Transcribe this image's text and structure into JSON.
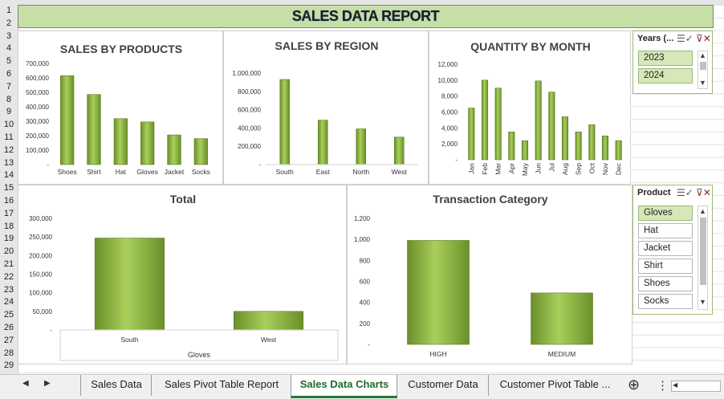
{
  "sheet": {
    "title": "SALES DATA REPORT",
    "row_numbers": [
      "1",
      "2",
      "3",
      "4",
      "5",
      "6",
      "7",
      "8",
      "9",
      "10",
      "11",
      "12",
      "13",
      "14",
      "15",
      "16",
      "17",
      "18",
      "19",
      "20",
      "21",
      "22",
      "23",
      "24",
      "25",
      "26",
      "27",
      "28",
      "29"
    ]
  },
  "colors": {
    "bar_light": "#a9cf5b",
    "bar_dark": "#6b8f2a",
    "accent_green": "#1e7b34",
    "slicer_selected": "#d6e8b8"
  },
  "chart_data": [
    {
      "type": "bar",
      "title": "SALES  BY PRODUCTS",
      "categories": [
        "Shoes",
        "Shirt",
        "Hat",
        "Gloves",
        "Jacket",
        "Socks"
      ],
      "values": [
        615000,
        485000,
        318000,
        295000,
        205000,
        180000
      ],
      "ylim": [
        0,
        700000
      ],
      "ytick_labels": [
        "-",
        "100,000",
        "200,000",
        "300,000",
        "400,000",
        "500,000",
        "600,000",
        "700,000"
      ]
    },
    {
      "type": "bar",
      "title": "SALES BY REGION",
      "categories": [
        "South",
        "East",
        "North",
        "West"
      ],
      "values": [
        930000,
        485000,
        390000,
        300000
      ],
      "ylim": [
        0,
        1000000
      ],
      "ytick_labels": [
        "-",
        "200,000",
        "400,000",
        "600,000",
        "800,000",
        "1,000,000"
      ]
    },
    {
      "type": "bar",
      "title": "QUANTITY BY MONTH",
      "categories": [
        "Jan",
        "Feb",
        "Mar",
        "Apr",
        "May",
        "Jun",
        "Jul",
        "Aug",
        "Sep",
        "Oct",
        "Nov",
        "Dec"
      ],
      "values": [
        6500,
        10000,
        9000,
        3500,
        2400,
        9900,
        8500,
        5400,
        3500,
        4400,
        3000,
        2400
      ],
      "ylim": [
        0,
        12000
      ],
      "ytick_labels": [
        "-",
        "2,000",
        "4,000",
        "6,000",
        "8,000",
        "10,000",
        "12,000"
      ]
    },
    {
      "type": "bar",
      "title": "Total",
      "categories": [
        "South",
        "West"
      ],
      "group_label": "Gloves",
      "values": [
        247000,
        50000
      ],
      "ylim": [
        0,
        300000
      ],
      "ytick_labels": [
        "-",
        "50,000",
        "100,000",
        "150,000",
        "200,000",
        "250,000",
        "300,000"
      ]
    },
    {
      "type": "bar",
      "title": "Transaction Category",
      "categories": [
        "HIGH",
        "MEDIUM"
      ],
      "values": [
        990000,
        490000
      ],
      "ylim": [
        0,
        1200
      ],
      "values_display": [
        990,
        490
      ],
      "ytick_labels": [
        "-",
        "200",
        "400",
        "600",
        "800",
        "1,000",
        "1,200"
      ]
    }
  ],
  "slicers": {
    "years": {
      "header": "Years (...",
      "items": [
        "2023",
        "2024"
      ],
      "selected": [
        "2023",
        "2024"
      ]
    },
    "product": {
      "header": "Product",
      "items": [
        "Gloves",
        "Hat",
        "Jacket",
        "Shirt",
        "Shoes",
        "Socks"
      ],
      "selected": [
        "Gloves"
      ]
    }
  },
  "tabs": {
    "items": [
      "Sales Data",
      "Sales Pivot Table Report",
      "Sales Data Charts",
      "Customer Data",
      "Customer Pivot Table"
    ],
    "active": "Sales Data Charts",
    "more": "...",
    "add_icon": "⊕",
    "menu_icon": "⋮"
  }
}
